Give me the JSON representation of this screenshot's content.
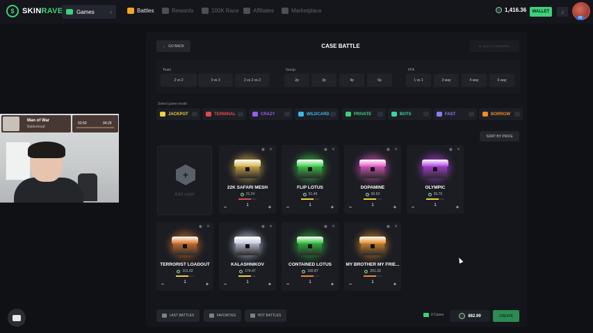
{
  "brand": {
    "name_a": "SKIN",
    "name_b": "RAVE"
  },
  "nav": {
    "games": "Games",
    "items": [
      {
        "label": "Battles",
        "icon": "swords-icon",
        "active": true
      },
      {
        "label": "Rewards",
        "icon": "gift-icon",
        "active": false
      },
      {
        "label": "100K Race",
        "icon": "flag-icon",
        "active": false
      },
      {
        "label": "Affiliates",
        "icon": "users-icon",
        "active": false
      },
      {
        "label": "Marketplace",
        "icon": "store-icon",
        "active": false
      }
    ]
  },
  "account": {
    "balance": "1,416.36",
    "wallet_label": "WALLET",
    "level": "86"
  },
  "page": {
    "title": "CASE BATTLE",
    "go_back": "GO BACK",
    "add_favorites": "ADD TO FAVORITES"
  },
  "options": {
    "team": {
      "label": "Team",
      "choices": [
        "2 vs 2",
        "3 vs 3",
        "2 vs 2 vs 2"
      ]
    },
    "group": {
      "label": "Group",
      "choices": [
        "2p",
        "3p",
        "4p",
        "6p"
      ]
    },
    "ffa": {
      "label": "FFA",
      "choices": [
        "1 vs 1",
        "3 way",
        "4 way",
        "6 way"
      ]
    }
  },
  "game_modes": {
    "label": "Select game mode:",
    "items": [
      {
        "label": "JACKPOT",
        "color": "#f3d23a"
      },
      {
        "label": "TERMINAL",
        "color": "#e04a4a"
      },
      {
        "label": "CRAZY",
        "color": "#9b5cf0"
      },
      {
        "label": "WILDCARD",
        "color": "#3fb6e8"
      },
      {
        "label": "PRIVATE",
        "color": "#3fd17a"
      },
      {
        "label": "BOTS",
        "color": "#3fd1a6"
      },
      {
        "label": "FAST",
        "color": "#8a7ff0"
      },
      {
        "label": "BORROW",
        "color": "#f08a2a"
      }
    ]
  },
  "sort_label": "SORT BY PRICE",
  "add_case_label": "Add case",
  "cases": [
    {
      "name": "22K SAFARI MESH",
      "price": "21.24",
      "qty": "1",
      "color": "#d9b24a",
      "bar": "#e04a4a"
    },
    {
      "name": "FLIP LOTUS",
      "price": "51.49",
      "qty": "1",
      "color": "#3fd14a",
      "bar": "#f3d23a"
    },
    {
      "name": "DOPAMINE",
      "price": "60.53",
      "qty": "1",
      "color": "#e45ac8",
      "bar": "#f3d23a"
    },
    {
      "name": "OLYMPIC",
      "price": "93.76",
      "qty": "1",
      "color": "#b23fe0",
      "bar": "#f3d23a"
    },
    {
      "name": "TERRORIST LOADOUT",
      "price": "101.02",
      "qty": "1",
      "color": "#d9772e",
      "bar": "#f3d23a"
    },
    {
      "name": "KALASHNIKOV",
      "price": "174.47",
      "qty": "1",
      "color": "#c9cde2",
      "bar": "#f3d23a"
    },
    {
      "name": "CONTAINED LOTUS",
      "price": "182.87",
      "qty": "1",
      "color": "#2fbf3a",
      "bar": "#f08a2a"
    },
    {
      "name": "MY BROTHER MY FRIE...",
      "price": "201.33",
      "qty": "1",
      "color": "#e08a2a",
      "bar": "#f08a2a"
    }
  ],
  "footer": {
    "last_battles": "LAST BATTLES",
    "favorites": "FAVORITES",
    "hot_battles": "HOT BATTLES",
    "cases_count": "0 Cases",
    "total": "882.99",
    "create": "CREATE"
  },
  "webcam": {
    "name": "Man of War",
    "subtitle": "Baldorhead",
    "time_left": "02:50",
    "time_right": "04:29"
  }
}
